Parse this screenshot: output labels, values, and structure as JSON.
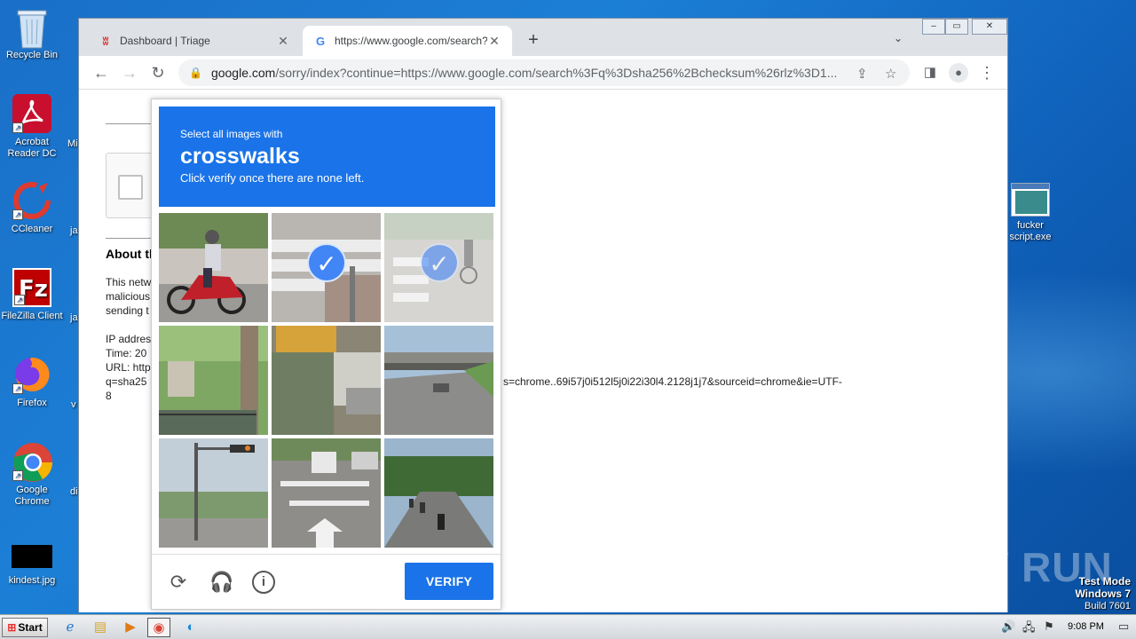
{
  "desktop": {
    "icons": [
      {
        "label": "Recycle Bin"
      },
      {
        "label": "Acrobat Reader DC"
      },
      {
        "label": "CCleaner"
      },
      {
        "label": "FileZilla Client"
      },
      {
        "label": "Firefox"
      },
      {
        "label": "Google Chrome"
      },
      {
        "label": "kindest.jpg"
      },
      {
        "label": "fucker script.exe"
      }
    ],
    "partial_labels": [
      "Mi",
      "ja",
      "ja",
      "v",
      "di"
    ]
  },
  "browser": {
    "tabs": [
      {
        "title": "Dashboard | Triage",
        "favicon": "triage-icon"
      },
      {
        "title": "https://www.google.com/search?q=",
        "favicon": "google-icon"
      }
    ],
    "new_tab": "+",
    "url_host": "google.com",
    "url_rest": "/sorry/index?continue=https://www.google.com/search%3Fq%3Dsha256%2Bchecksum%26rlz%3D1..."
  },
  "page": {
    "about_heading": "About th",
    "para1": [
      "This netw",
      "malicious",
      "sending t"
    ],
    "ip_line": "IP addres",
    "time_line": "Time: 20",
    "url_line": "URL: http",
    "q_line": "q=sha25",
    "url_tail": "s=chrome..69i57j0i512l5j0i22i30l4.2128j1j7&sourceid=chrome&ie=UTF-",
    "url_tail2": "8"
  },
  "captcha": {
    "instruction_small": "Select all images with",
    "target": "crosswalks",
    "instruction_sub": "Click verify once there are none left.",
    "verify_label": "VERIFY",
    "selected_tiles": [
      1,
      2
    ]
  },
  "watermark": "ANY RUN",
  "testmode": {
    "line1": "Test Mode",
    "line2": "Windows 7",
    "line3": "Build 7601"
  },
  "taskbar": {
    "start_label": "Start",
    "clock": "9:08 PM"
  }
}
